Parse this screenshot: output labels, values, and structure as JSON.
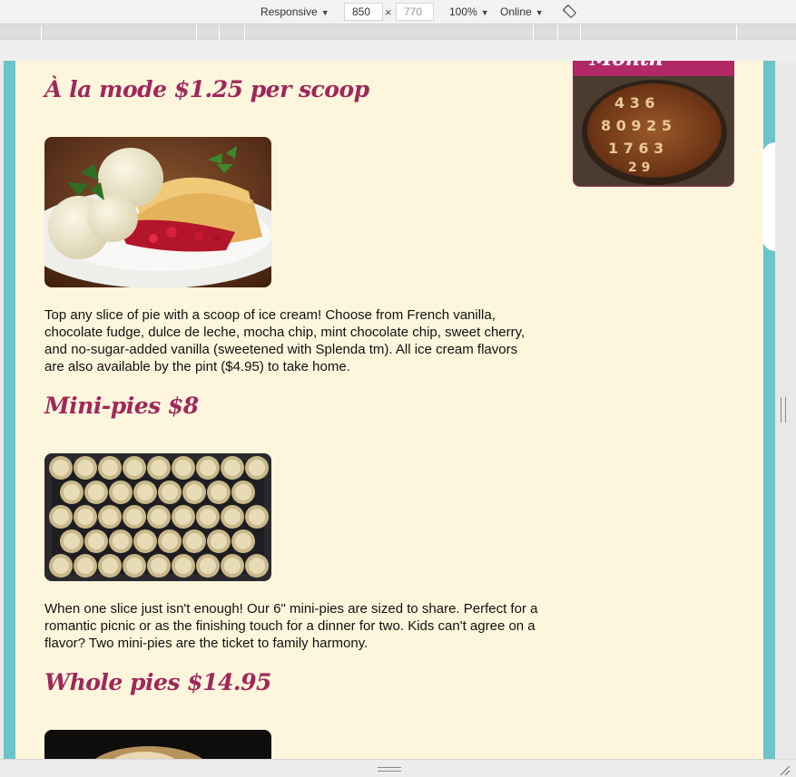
{
  "devtools": {
    "device": "Responsive",
    "width": "850",
    "height": "770",
    "zoom": "100%",
    "network": "Online",
    "times_sign": "×"
  },
  "sidebar": {
    "banner_text": "Month"
  },
  "sections": [
    {
      "title": "À la mode $1.25 per scoop",
      "image": "pie-with-ice-cream",
      "description": "Top any slice of pie with a scoop of ice cream! Choose from French vanilla, chocolate fudge, dulce de leche, mocha chip, mint chocolate chip, sweet cherry, and no-sugar-added vanilla (sweetened with Splenda tm). All ice cream flavors are also available by the pint ($4.95) to take home."
    },
    {
      "title": "Mini-pies $8",
      "image": "tray-of-mini-pies",
      "description": "When one slice just isn't enough! Our 6\" mini-pies are sized to share. Perfect for a romantic picnic or as the finishing touch for a dinner for two. Kids can't agree on a flavor? Two mini-pies are the ticket to family harmony."
    },
    {
      "title": "Whole pies $14.95",
      "image": "whole-pie"
    }
  ],
  "colors": {
    "heading": "#a0275a",
    "page_bg": "#fdf6dc",
    "frame": "#6cc3c9",
    "banner": "#b12a67"
  }
}
